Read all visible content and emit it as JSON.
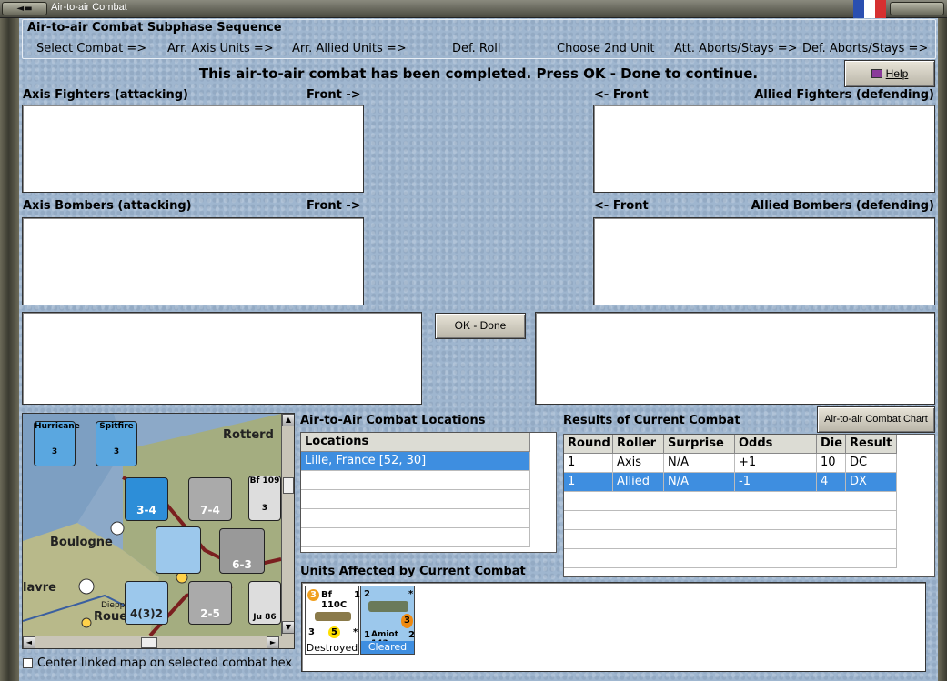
{
  "window": {
    "title": "Air-to-air Combat",
    "flag_colors": [
      "#2a4fb0",
      "#ffffff",
      "#d63030"
    ]
  },
  "sequence": {
    "title": "Air-to-air Combat Subphase Sequence",
    "steps": [
      "Select Combat =>",
      "Arr. Axis Units =>",
      "Arr. Allied Units =>",
      "Def. Roll",
      "Choose 2nd Unit",
      "Att. Aborts/Stays =>",
      "Def. Aborts/Stays =>"
    ]
  },
  "banner": "This air-to-air combat has been completed.  Press OK - Done to continue.",
  "help_label": "Help",
  "panels": {
    "axis_fighters": "Axis Fighters (attacking)",
    "axis_front": "Front ->",
    "allied_front": "<- Front",
    "allied_fighters": "Allied Fighters (defending)",
    "axis_bombers": "Axis Bombers (attacking)",
    "allied_bombers": "Allied Bombers (defending)"
  },
  "ok_label": "OK - Done",
  "locations": {
    "title": "Air-to-Air Combat Locations",
    "header": "Locations",
    "rows": [
      "Lille, France [52, 30]"
    ]
  },
  "results": {
    "title": "Results of Current Combat",
    "chart_button": "Air-to-air Combat Chart",
    "headers": [
      "Round",
      "Roller",
      "Surprise",
      "Odds",
      "Die",
      "Result"
    ],
    "rows": [
      [
        "1",
        "Axis",
        "N/A",
        "+1",
        "10",
        "DC"
      ],
      [
        "1",
        "Allied",
        "N/A",
        "-1",
        "4",
        "DX"
      ]
    ]
  },
  "affected": {
    "title": "Units Affected by Current Combat",
    "units": [
      {
        "name": "Bf 110C",
        "top_left": "3",
        "top_right": "1",
        "bottom_left": "3",
        "bottom_mid": "5",
        "bottom_right": "*",
        "status": "Destroyed"
      },
      {
        "name": "Amiot 143",
        "top_left": "2",
        "top_right": "*",
        "bottom_left": "1",
        "bottom_mid": "3",
        "bottom_right": "2",
        "status": "Cleared"
      }
    ]
  },
  "map": {
    "labels": [
      "Rotterd",
      "Boulogne",
      "lavre",
      "Dieppe",
      "Roue"
    ],
    "counters": [
      {
        "name": "Hurricane",
        "value": "3"
      },
      {
        "name": "Spitfire",
        "value": "3"
      },
      {
        "name": "3-4",
        "value": "3-4"
      },
      {
        "name": "7-4",
        "value": "7-4"
      },
      {
        "name": "Bf 109",
        "value": "3"
      },
      {
        "name": "6-3",
        "value": "6-3"
      },
      {
        "name": "4(3)2",
        "value": "4(3)2"
      },
      {
        "name": "2-5",
        "value": "2-5"
      },
      {
        "name": "Ju 86",
        "value": "2"
      }
    ]
  },
  "center_checkbox": "Center linked map on selected combat hex"
}
